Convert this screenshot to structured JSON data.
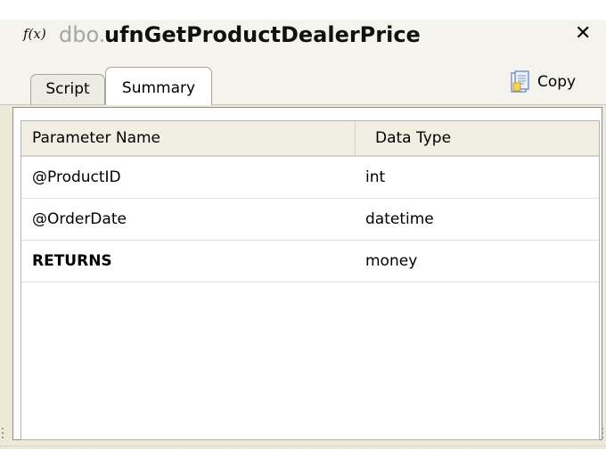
{
  "window": {
    "icon_label": "f(x)",
    "schema": "dbo.",
    "function_name": "ufnGetProductDealerPrice",
    "close_glyph": "✕"
  },
  "tabs": [
    {
      "label": "Script",
      "active": false
    },
    {
      "label": "Summary",
      "active": true
    }
  ],
  "copy": {
    "label": "Copy",
    "icon": "copy-document-icon"
  },
  "table": {
    "headers": [
      "Parameter Name",
      "Data Type"
    ],
    "rows": [
      {
        "name": "@ProductID",
        "type": "int",
        "bold": false
      },
      {
        "name": "@OrderDate",
        "type": "datetime",
        "bold": false
      },
      {
        "name": "RETURNS",
        "type": "money",
        "bold": true
      }
    ]
  }
}
